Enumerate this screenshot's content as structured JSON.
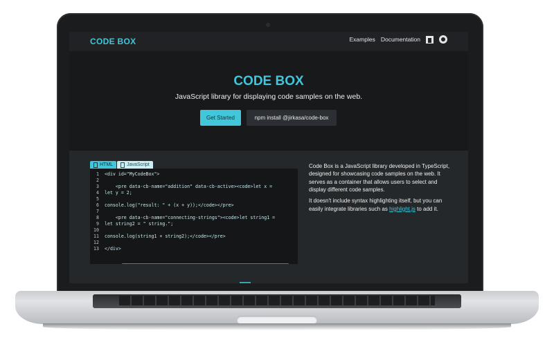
{
  "site": {
    "brand": "CODE BOX",
    "nav": [
      {
        "label": "Examples"
      },
      {
        "label": "Documentation"
      }
    ],
    "nav_icons": [
      "npm-icon",
      "github-icon"
    ]
  },
  "hero": {
    "title": "CODE BOX",
    "subtitle": "JavaScript library for displaying code samples on the web.",
    "primary_button": "Get Started",
    "secondary_button": "npm install @jirkasa/code-box"
  },
  "demo": {
    "tabs": [
      {
        "label": "HTML",
        "active": true
      },
      {
        "label": "JavaScript",
        "active": false
      }
    ],
    "code_lines": [
      {
        "n": "1",
        "text": "<div id=\"MyCodeBox\">"
      },
      {
        "n": "2",
        "text": ""
      },
      {
        "n": "3",
        "text": "    <pre data-cb-name=\"addition\" data-cb-active><code>let x ="
      },
      {
        "n": "4",
        "text": "let y = 2;"
      },
      {
        "n": "5",
        "text": ""
      },
      {
        "n": "6",
        "text": "console.log(\"result: \" + (x + y));</code></pre>"
      },
      {
        "n": "7",
        "text": ""
      },
      {
        "n": "8",
        "text": "    <pre data-cb-name=\"connecting-strings\"><code>let string1 ="
      },
      {
        "n": "9",
        "text": "let string2 = \" string.\";"
      },
      {
        "n": "10",
        "text": ""
      },
      {
        "n": "11",
        "text": "console.log(string1 + string2);</code></pre>"
      },
      {
        "n": "12",
        "text": ""
      },
      {
        "n": "13",
        "text": "</div>"
      }
    ],
    "description": {
      "p1": "Code Box is a JavaScript library developed in TypeScript, designed for showcasing code samples on the web. It serves as a container that allows users to select and display different code samples.",
      "p2_before": "It doesn't include syntax highlighting itself, but you can easily integrate libraries such as ",
      "p2_link": "highlight.js",
      "p2_after": " to add it."
    }
  },
  "colors": {
    "accent": "#41c7d9",
    "background": "#17191b",
    "panel": "#24282b"
  }
}
